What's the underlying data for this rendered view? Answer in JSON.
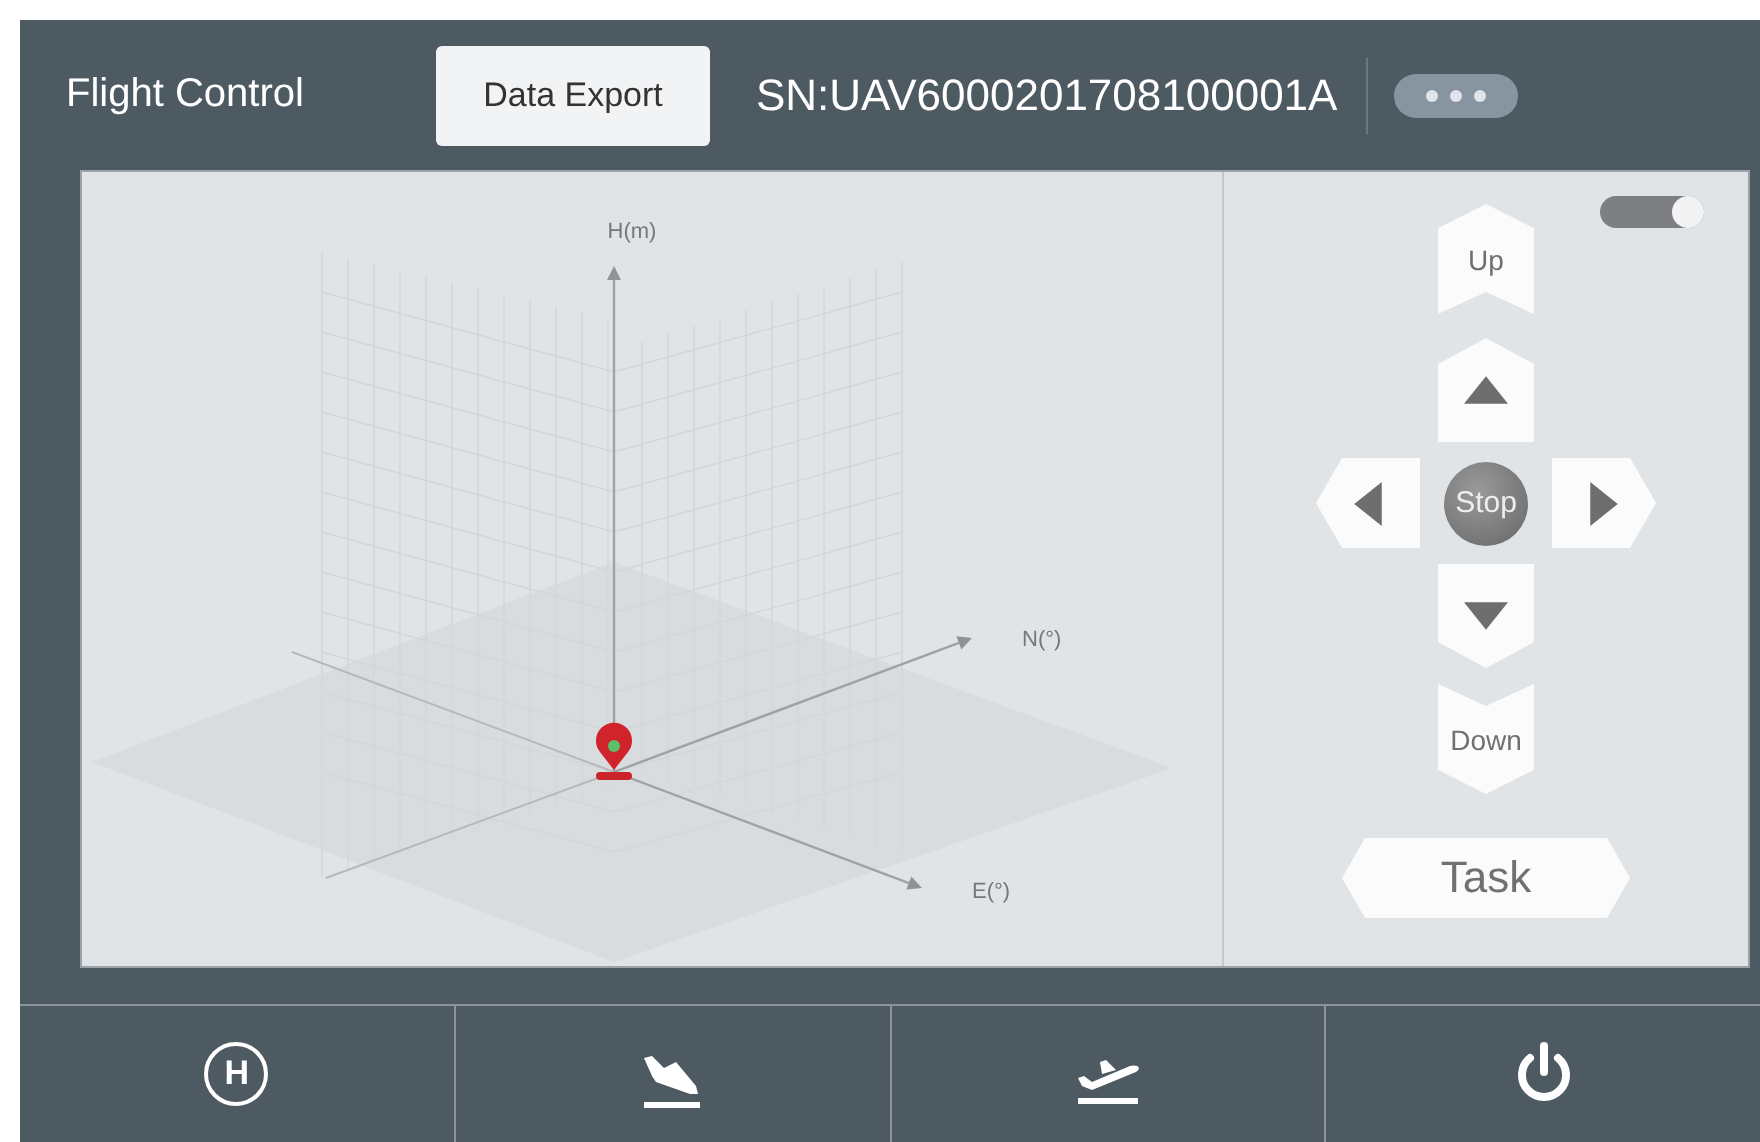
{
  "header": {
    "title": "Flight Control",
    "export_button": "Data Export",
    "serial": "SN:UAV6000201708100001A"
  },
  "plot": {
    "axes": [
      {
        "kind": "height",
        "label": "H(m)"
      },
      {
        "kind": "north",
        "label": "N(°)"
      },
      {
        "kind": "east",
        "label": "E(°)"
      }
    ]
  },
  "controls": {
    "toggle": {
      "on": true
    },
    "up": "Up",
    "stop": "Stop",
    "down": "Down",
    "task": "Task"
  },
  "bottom_bar": [
    {
      "kind": "home",
      "label": "H"
    },
    {
      "kind": "land"
    },
    {
      "kind": "takeoff"
    },
    {
      "kind": "power"
    }
  ]
}
